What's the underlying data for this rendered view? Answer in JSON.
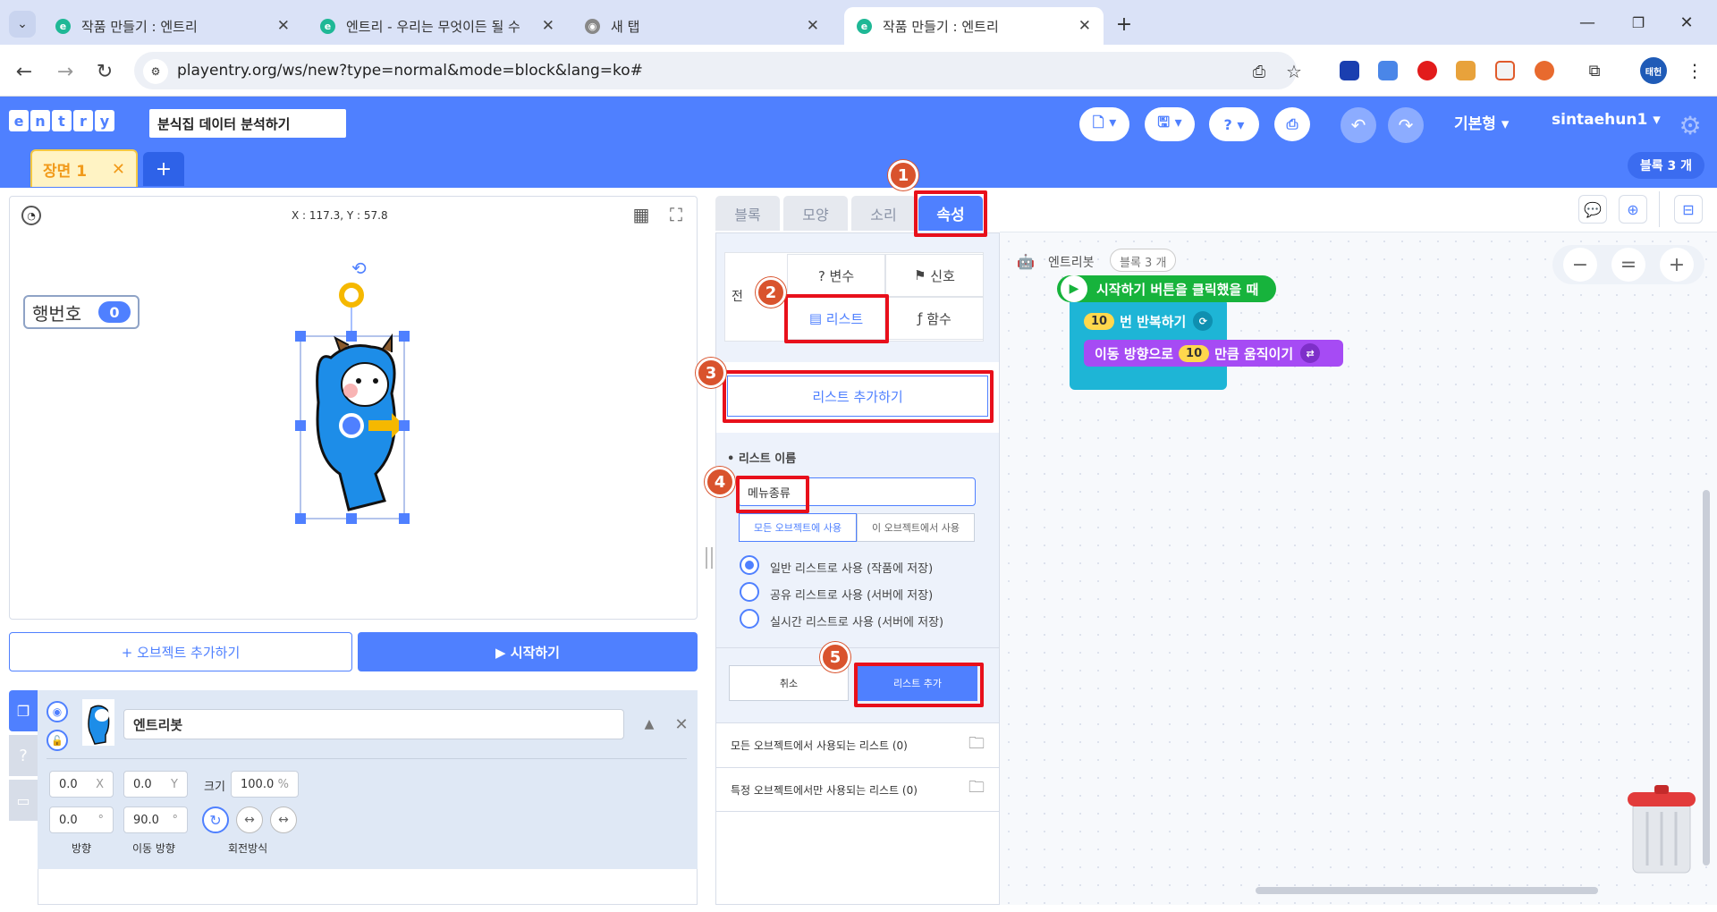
{
  "browser": {
    "tabs": [
      {
        "title": "작품 만들기 : 엔트리",
        "favicon": "e"
      },
      {
        "title": "엔트리 - 우리는 무엇이든 될 수",
        "favicon": "e"
      },
      {
        "title": "새 탭",
        "favicon": "chrome-icon"
      },
      {
        "title": "작품 만들기 : 엔트리",
        "favicon": "e"
      }
    ],
    "url": "playentry.org/ws/new?type=normal&mode=block&lang=ko#",
    "profile_label": "태헌"
  },
  "header": {
    "logo": "entry",
    "project_title": "분식집 데이터 분석하기",
    "mode": "기본형",
    "user": "sintaehun1",
    "block_count": "블록 3 개"
  },
  "scene": {
    "tab_label": "장면 1",
    "close": "✕",
    "add": "+"
  },
  "stage": {
    "coords": "X : 117.3, Y : 57.8",
    "variable_label": "행번호",
    "variable_value": "0"
  },
  "buttons": {
    "add_object": "+ 오브젝트 추가하기",
    "start": "▶ 시작하기"
  },
  "object": {
    "name": "엔트리봇",
    "x": "0.0",
    "x_unit": "X",
    "y": "0.0",
    "y_unit": "Y",
    "size_label": "크기",
    "size": "100.0",
    "size_unit": "%",
    "direction": "0.0",
    "direction_unit": "°",
    "move_direction": "90.0",
    "move_direction_unit": "°",
    "direction_label": "방향",
    "move_direction_label": "이동 방향",
    "rotation_label": "회전방식"
  },
  "prop_tabs": [
    "블록",
    "모양",
    "소리",
    "속성"
  ],
  "attr": {
    "partial_label": "전",
    "variable": "? 변수",
    "signal": "신호",
    "list": "리스트",
    "function": "함수",
    "add_list": "리스트 추가하기",
    "list_name_label": "리스트 이름",
    "list_name_value": "메뉴종류",
    "scope_all": "모든 오브젝트에 사용",
    "scope_this": "이 오브젝트에서 사용",
    "radio": [
      "일반 리스트로 사용 (작품에 저장)",
      "공유 리스트로 사용 (서버에 저장)",
      "실시간 리스트로 사용 (서버에 저장)"
    ],
    "cancel": "취소",
    "confirm": "리스트 추가",
    "all_lists": "모든 오브젝트에서 사용되는 리스트 (0)",
    "specific_lists": "특정 오브젝트에서만 사용되는 리스트 (0)"
  },
  "markers": [
    "1",
    "2",
    "3",
    "4",
    "5"
  ],
  "workspace": {
    "object_name": "엔트리봇",
    "block_badge": "블록 3 개",
    "when_start": "시작하기 버튼을 클릭했을 때",
    "repeat_value": "10",
    "repeat_label": "번 반복하기",
    "move_label": "이동 방향으로",
    "move_value": "10",
    "move_label2": "만큼 움직이기"
  },
  "colors": {
    "brand": "#4f80ff",
    "highlight": "#e8101b",
    "marker": "#d9532d",
    "start_block": "#17b33c",
    "flow_block": "#1eb5d6",
    "move_block": "#a64bf4"
  }
}
